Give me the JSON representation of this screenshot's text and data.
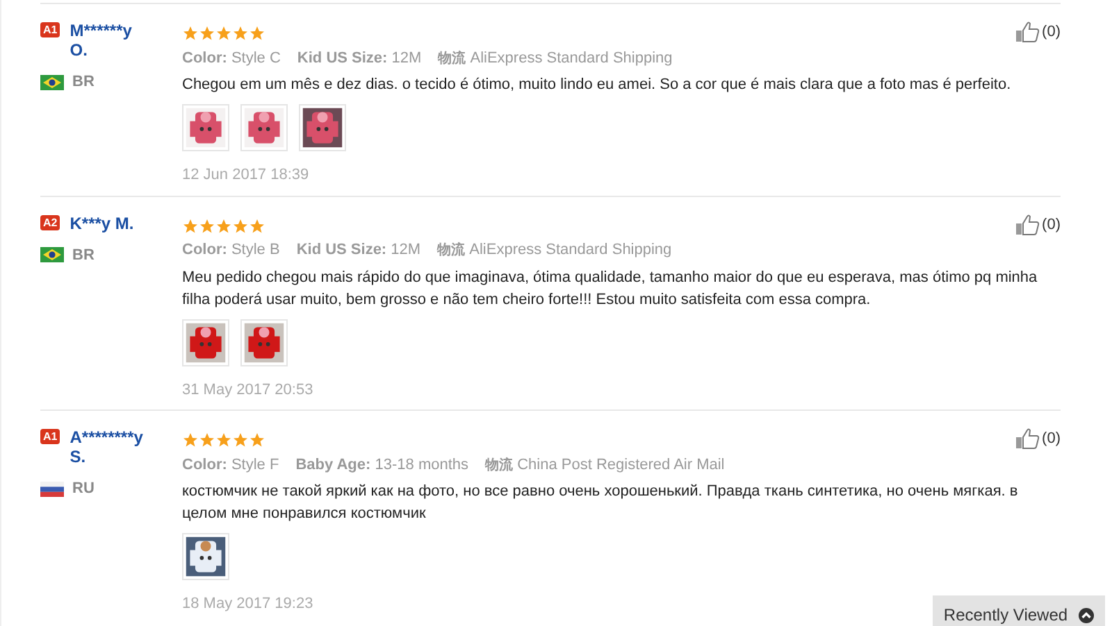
{
  "reviews": [
    {
      "badge": "A1",
      "name": "M******y O.",
      "flag": {
        "kind": "br"
      },
      "country": "BR",
      "stars": 5,
      "attributes": [
        {
          "label": "Color:",
          "value": "Style C"
        },
        {
          "label": "Kid US Size:",
          "value": "12M"
        }
      ],
      "shipping": {
        "label": "物流",
        "value": "AliExpress Standard Shipping"
      },
      "text": "Chegou em um mês e dez dias. o tecido é ótimo, muito lindo eu amei. So a cor que é mais clara que a foto mas é perfeito.",
      "photos": [
        {
          "kind": "picture"
        },
        {
          "kind": "picture"
        },
        {
          "kind": "picture"
        }
      ],
      "date": "12 Jun 2017 18:39",
      "likes": "(0)"
    },
    {
      "badge": "A2",
      "name": "K***y M.",
      "flag": {
        "kind": "br"
      },
      "country": "BR",
      "stars": 5,
      "attributes": [
        {
          "label": "Color:",
          "value": "Style B"
        },
        {
          "label": "Kid US Size:",
          "value": "12M"
        }
      ],
      "shipping": {
        "label": "物流",
        "value": "AliExpress Standard Shipping"
      },
      "text": "Meu pedido chegou mais rápido do que imaginava, ótima qualidade, tamanho maior do que eu esperava, mas ótimo pq minha filha poderá usar muito, bem grosso e não tem cheiro forte!!! Estou muito satisfeita com essa compra.",
      "photos": [
        {
          "kind": "picture"
        },
        {
          "kind": "picture"
        }
      ],
      "date": "31 May 2017 20:53",
      "likes": "(0)"
    },
    {
      "badge": "A1",
      "name": "A********y S.",
      "flag": {
        "kind": "ru"
      },
      "country": "RU",
      "stars": 5,
      "attributes": [
        {
          "label": "Color:",
          "value": "Style F"
        },
        {
          "label": "Baby Age:",
          "value": "13-18 months"
        }
      ],
      "shipping": {
        "label": "物流",
        "value": "China Post Registered Air Mail"
      },
      "text": "костюмчик не такой яркий как на фото, но все равно очень хорошенький. Правда ткань синтетика, но очень мягкая. в целом мне понравился костюмчик",
      "photos": [
        {
          "kind": "picture"
        }
      ],
      "date": "18 May 2017 19:23",
      "likes": "(0)"
    }
  ],
  "recently_viewed": {
    "label": "Recently Viewed"
  }
}
